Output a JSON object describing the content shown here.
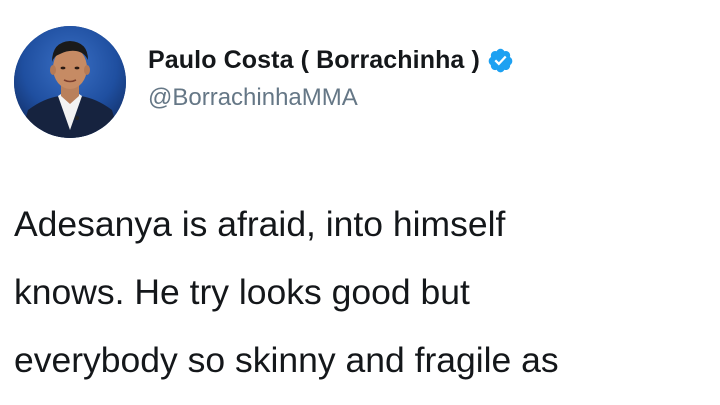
{
  "user": {
    "display_name": "Paulo Costa ( Borrachinha )",
    "handle": "@BorrachinhaMMA",
    "verified": true,
    "verified_icon": "verified-badge-icon",
    "verified_color": "#1da1f2"
  },
  "tweet": {
    "lines": [
      "Adesanya is afraid, into himself",
      "knows. He try looks good but",
      "everybody so skinny and fragile as"
    ]
  }
}
